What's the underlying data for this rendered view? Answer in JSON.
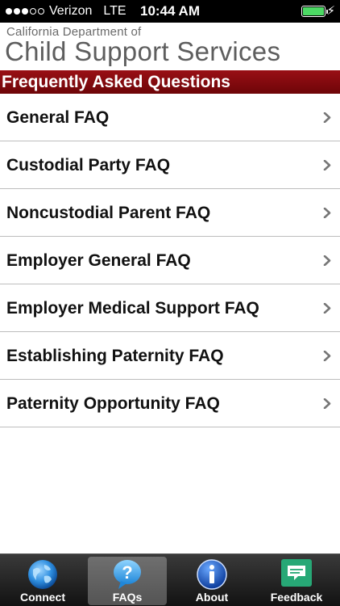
{
  "status_bar": {
    "carrier": "Verizon",
    "network": "LTE",
    "time": "10:44 AM",
    "signal_bars": 3,
    "signal_total": 5,
    "battery_level": 1.0,
    "battery_color": "#4cd964"
  },
  "header": {
    "logo_line1": "California Department of",
    "logo_line2": "Child Support Services"
  },
  "section": {
    "title": "Frequently Asked Questions",
    "color": "#8b0a10"
  },
  "faq_items": [
    {
      "label": "General FAQ"
    },
    {
      "label": "Custodial Party FAQ"
    },
    {
      "label": "Noncustodial Parent FAQ"
    },
    {
      "label": "Employer General FAQ"
    },
    {
      "label": "Employer Medical Support FAQ"
    },
    {
      "label": "Establishing Paternity FAQ"
    },
    {
      "label": "Paternity Opportunity FAQ"
    }
  ],
  "tab_bar": {
    "tabs": [
      {
        "label": "Connect",
        "icon": "globe-icon",
        "selected": false
      },
      {
        "label": "FAQs",
        "icon": "question-bubble-icon",
        "selected": true
      },
      {
        "label": "About",
        "icon": "info-icon",
        "selected": false
      },
      {
        "label": "Feedback",
        "icon": "feedback-message-icon",
        "selected": false
      }
    ]
  }
}
